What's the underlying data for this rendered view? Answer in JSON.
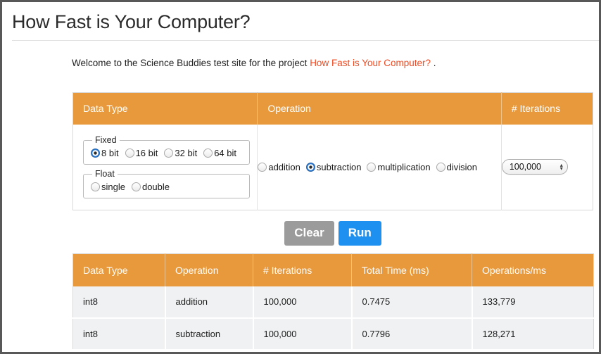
{
  "page": {
    "title": "How Fast is Your Computer?"
  },
  "intro": {
    "before": "Welcome to the Science Buddies test site for the project ",
    "link": "How Fast is Your Computer?",
    "after": " .",
    "link_color": "#f04a22"
  },
  "form": {
    "headers": [
      "Data Type",
      "Operation",
      "# Iterations"
    ],
    "data_type": {
      "fixed": {
        "legend": "Fixed",
        "options": [
          {
            "label": "8 bit",
            "selected": true
          },
          {
            "label": "16 bit",
            "selected": false
          },
          {
            "label": "32 bit",
            "selected": false
          },
          {
            "label": "64 bit",
            "selected": false
          }
        ]
      },
      "float": {
        "legend": "Float",
        "options": [
          {
            "label": "single",
            "selected": false
          },
          {
            "label": "double",
            "selected": false
          }
        ]
      }
    },
    "operation": {
      "options": [
        {
          "label": "addition",
          "selected": false
        },
        {
          "label": "subtraction",
          "selected": true
        },
        {
          "label": "multiplication",
          "selected": false
        },
        {
          "label": "division",
          "selected": false
        }
      ]
    },
    "iterations": {
      "value": "100,000",
      "stepper_up": "▴",
      "stepper_down": "▾"
    }
  },
  "buttons": {
    "clear": "Clear",
    "run": "Run"
  },
  "results": {
    "headers": [
      "Data Type",
      "Operation",
      "# Iterations",
      "Total Time (ms)",
      "Operations/ms"
    ],
    "rows": [
      [
        "int8",
        "addition",
        "100,000",
        "0.7475",
        "133,779"
      ],
      [
        "int8",
        "subtraction",
        "100,000",
        "0.7796",
        "128,271"
      ]
    ]
  },
  "colors": {
    "header_orange": "#e8993c",
    "run_blue": "#1e90f0",
    "clear_gray": "#9b9b9b",
    "row_gray": "#f0f1f2"
  }
}
